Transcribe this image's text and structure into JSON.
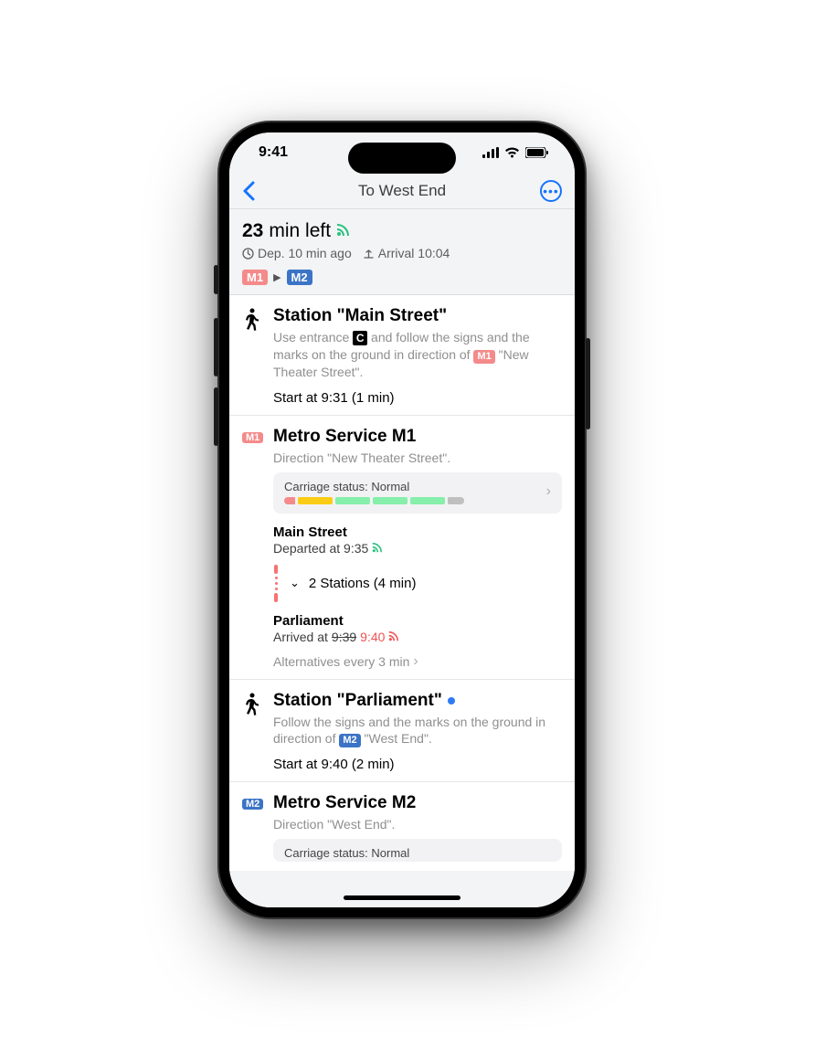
{
  "status": {
    "time": "9:41"
  },
  "nav": {
    "title": "To West End"
  },
  "summary": {
    "duration_strong": "23",
    "duration_rest": "min left",
    "departure": "Dep. 10 min ago",
    "arrival": "Arrival 10:04",
    "route_sep": "▶",
    "line1": {
      "label": "M1",
      "color": "#f48a8a"
    },
    "line2": {
      "label": "M2",
      "color": "#3b74c6"
    }
  },
  "colors": {
    "accent": "#1573ff",
    "live_green": "#27c07d",
    "delay_red": "#f05252"
  },
  "steps": [
    {
      "type": "walk",
      "title": "Station \"Main Street\"",
      "desc_pre": "Use entrance ",
      "entrance": "C",
      "desc_mid": " and follow the signs and the marks on the ground in direction of ",
      "inline_line": {
        "label": "M1",
        "color": "#f48a8a"
      },
      "desc_post": " \"New Theater Street\".",
      "meta": "Start at 9:31 (1 min)"
    },
    {
      "type": "metro",
      "line": {
        "label": "M1",
        "color": "#f48a8a"
      },
      "title": "Metro Service M1",
      "direction": "Direction \"New Theater Street\".",
      "carriage_label": "Carriage status: Normal",
      "carriage": [
        "#f48a8a",
        "#facc15",
        "#86efac",
        "#86efac",
        "#86efac"
      ],
      "from_stop": "Main Street",
      "from_time": "Departed at 9:35",
      "between": "2 Stations (4 min)",
      "to_stop": "Parliament",
      "to_time_prefix": "Arrived at ",
      "to_time_old": "9:39",
      "to_time_new": "9:40",
      "alternatives": "Alternatives every 3 min"
    },
    {
      "type": "walk",
      "title": "Station \"Parliament\"",
      "live": true,
      "desc_pre": "Follow the signs and the marks on the ground in direction of ",
      "inline_line": {
        "label": "M2",
        "color": "#3b74c6"
      },
      "desc_post": " \"West End\".",
      "meta": "Start at 9:40 (2 min)"
    },
    {
      "type": "metro",
      "line": {
        "label": "M2",
        "color": "#3b74c6"
      },
      "title": "Metro Service M2",
      "direction": "Direction \"West End\".",
      "carriage_label": "Carriage status: Normal"
    }
  ]
}
